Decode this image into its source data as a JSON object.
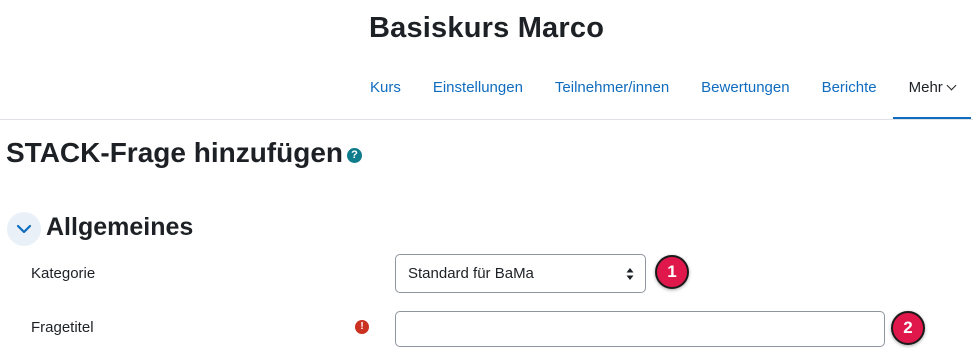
{
  "header": {
    "course_title": "Basiskurs Marco"
  },
  "nav": {
    "items": [
      {
        "label": "Kurs"
      },
      {
        "label": "Einstellungen"
      },
      {
        "label": "Teilnehmer/innen"
      },
      {
        "label": "Bewertungen"
      },
      {
        "label": "Berichte"
      },
      {
        "label": "Mehr",
        "active": true
      }
    ]
  },
  "page": {
    "title": "STACK-Frage hinzufügen",
    "help_icon": "?"
  },
  "section": {
    "title": "Allgemeines",
    "expanded": true
  },
  "form": {
    "category": {
      "label": "Kategorie",
      "selected": "Standard für BaMa"
    },
    "question_title": {
      "label": "Fragetitel",
      "value": "",
      "required": true,
      "required_icon": "!"
    }
  },
  "annotations": [
    {
      "number": "1"
    },
    {
      "number": "2"
    }
  ],
  "colors": {
    "link": "#0f6cbf",
    "badge": "#e0174b",
    "help": "#0f7c8c",
    "required": "#ca3120"
  }
}
